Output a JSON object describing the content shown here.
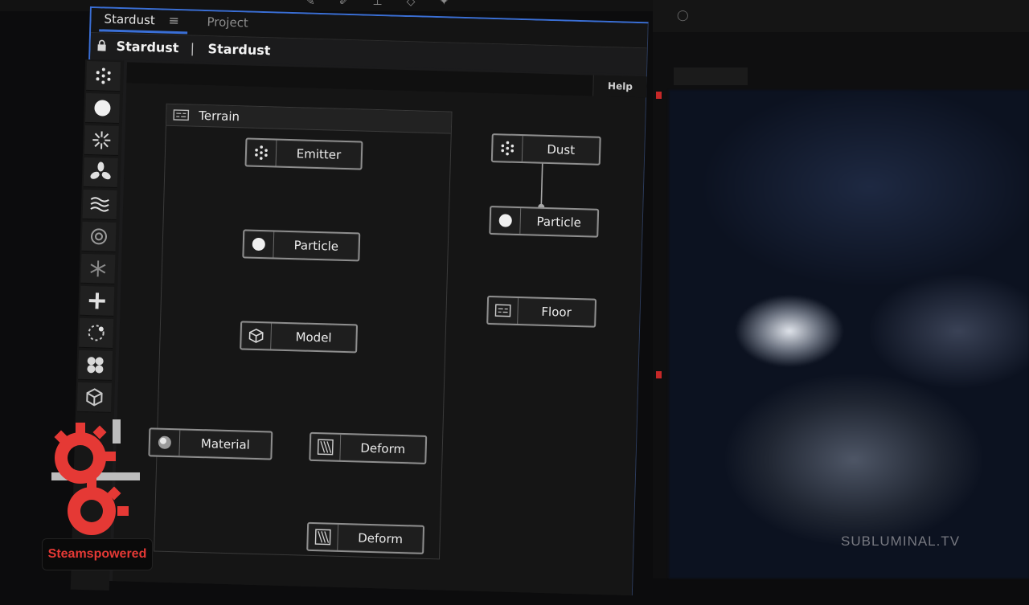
{
  "panel": {
    "tabs": [
      {
        "label": "Stardust"
      },
      {
        "label": "Project"
      }
    ],
    "menu_glyph": "≡",
    "header": {
      "left": "Stardust",
      "separator": "|",
      "right": "Stardust"
    },
    "help": "Help"
  },
  "toolbar": {
    "tools": [
      {
        "icon": "emitter-icon"
      },
      {
        "icon": "particle-icon"
      },
      {
        "icon": "burst-icon"
      },
      {
        "icon": "fan-force-icon"
      },
      {
        "icon": "turbulence-icon"
      },
      {
        "icon": "ring-icon"
      },
      {
        "icon": "snowflake-icon"
      },
      {
        "icon": "plus-icon"
      },
      {
        "icon": "spin-icon"
      },
      {
        "icon": "cluster-icon"
      },
      {
        "icon": "cube-icon"
      }
    ]
  },
  "graph": {
    "group_title": "Terrain",
    "nodes": {
      "emitter": "Emitter",
      "particle": "Particle",
      "model": "Model",
      "material": "Material",
      "deform1": "Deform",
      "deform2": "Deform",
      "dust": "Dust",
      "dust_particle": "Particle",
      "floor": "Floor"
    }
  },
  "viewer": {
    "watermark": "SUBLUMINAL.TV"
  },
  "logo": {
    "text": "Steamspowered"
  },
  "colors": {
    "accent": "#3a6fd6",
    "node_border": "#8e8e8e",
    "logo_red": "#e53935"
  }
}
